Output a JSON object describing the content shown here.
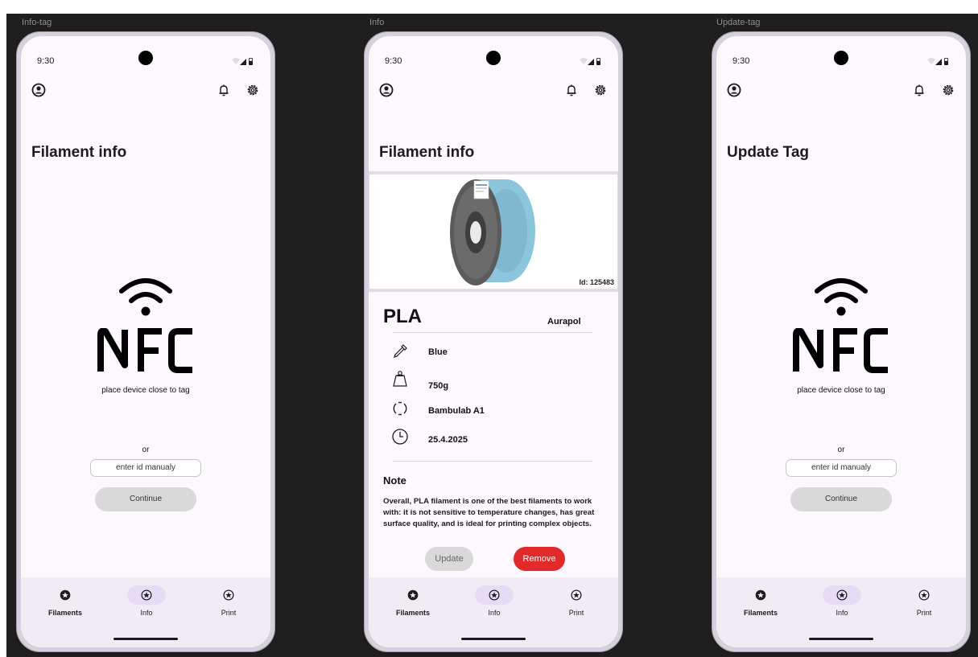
{
  "frames": {
    "info_tag": "Info-tag",
    "info": "Info",
    "update_tag": "Update-tag"
  },
  "status_bar": {
    "time": "9:30"
  },
  "icons": {
    "profile": "account-circle-icon",
    "notifications": "bell-icon",
    "settings": "gear-icon",
    "nav": "star-circle-icon"
  },
  "screens": {
    "info_tag": {
      "title": "Filament info",
      "nfc_caption": "place device close to tag",
      "or_text": "or",
      "id_input_placeholder": "enter id manualy",
      "continue_label": "Continue"
    },
    "info": {
      "title": "Filament info",
      "image_id": "Id: 125483",
      "material": "PLA",
      "brand": "Aurapol",
      "properties": [
        {
          "icon": "eyedropper-icon",
          "value": "Blue"
        },
        {
          "icon": "weight-icon",
          "value": "750g"
        },
        {
          "icon": "spool-ring-icon",
          "value": "Bambulab A1"
        },
        {
          "icon": "clock-icon",
          "value": "25.4.2025"
        }
      ],
      "note_title": "Note",
      "note_body": "Overall, PLA filament is one of the best filaments to work with: it is not sensitive to temperature changes, has great surface quality, and is ideal for printing complex objects.",
      "update_label": "Update",
      "remove_label": "Remove"
    },
    "update_tag": {
      "title": "Update Tag",
      "nfc_caption": "place device close to tag",
      "or_text": "or",
      "id_input_placeholder": "enter id manualy",
      "continue_label": "Continue"
    }
  },
  "nav": {
    "items": [
      {
        "label": "Filaments"
      },
      {
        "label": "Info"
      },
      {
        "label": "Print"
      }
    ],
    "active": "Info"
  },
  "colors": {
    "background": "#1e1e1e",
    "screen": "#fdf7fe",
    "nav_bar": "#f1ecf4",
    "active_pill": "#e7dcf6",
    "remove_button": "#e32a2a",
    "disabled_button": "#d9d9d9",
    "filament": "#8cc6dc"
  }
}
